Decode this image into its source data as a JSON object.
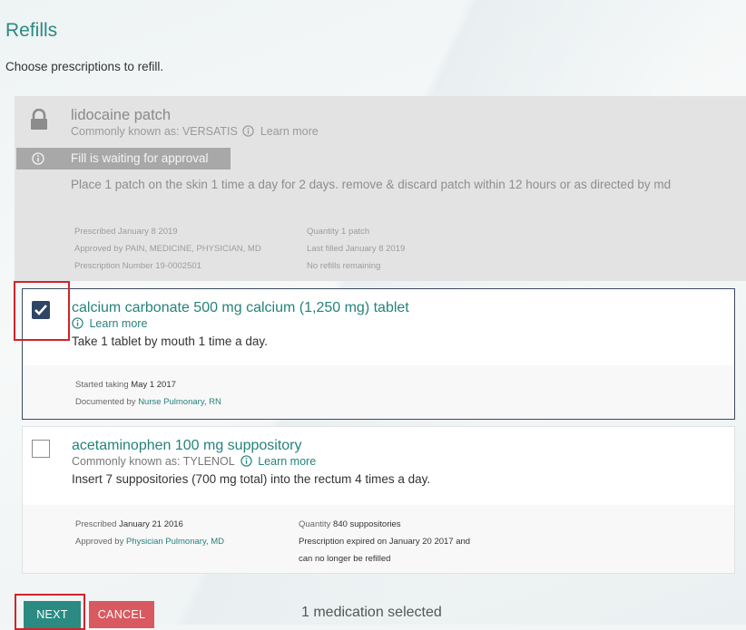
{
  "page": {
    "title": "Refills",
    "subtitle": "Choose prescriptions to refill."
  },
  "medications": [
    {
      "name": "lidocaine patch",
      "known_as": "Commonly known as: VERSATIS",
      "learn_more": "Learn more",
      "status": "Fill is waiting for approval",
      "directions": "Place 1 patch on the skin 1 time a day for 2 days. remove & discard patch within 12 hours or as directed by md",
      "locked": true,
      "selected": false,
      "meta_left": [
        "Prescribed January 8 2019",
        "Approved by PAIN, MEDICINE, PHYSICIAN, MD",
        "Prescription Number 19-0002501"
      ],
      "meta_right": [
        "Quantity 1 patch",
        "Last filled January 8 2019",
        "No refills remaining"
      ]
    },
    {
      "name": "calcium carbonate 500 mg calcium (1,250 mg) tablet",
      "learn_more": "Learn more",
      "directions": "Take 1 tablet by mouth 1 time a day.",
      "locked": false,
      "selected": true,
      "started_label": "Started taking",
      "started_value": "May 1 2017",
      "documented_label": "Documented by",
      "documented_value": "Nurse Pulmonary, RN"
    },
    {
      "name": "acetaminophen 100 mg suppository",
      "known_as": "Commonly known as: TYLENOL",
      "learn_more": "Learn more",
      "directions": "Insert 7 suppositories (700 mg total) into the rectum 4 times a day.",
      "locked": false,
      "selected": false,
      "prescribed_label": "Prescribed",
      "prescribed_value": "January 21 2016",
      "approved_label": "Approved by",
      "approved_value": "Physician Pulmonary, MD",
      "quantity_label": "Quantity",
      "quantity_value": "840 suppositories",
      "expired_line1": "Prescription expired on January 20 2017 and",
      "expired_line2": "can no longer be refilled"
    }
  ],
  "actions": {
    "next_label": "NEXT",
    "cancel_label": "CANCEL",
    "selection_status": "1 medication selected"
  },
  "icons": {
    "lock": "lock-icon",
    "info": "info-icon",
    "check": "checkmark-icon"
  },
  "colors": {
    "accent": "#2b8b82",
    "cancel": "#d85a60",
    "checkbox_checked": "#2f4566",
    "highlight": "#d2232a"
  }
}
